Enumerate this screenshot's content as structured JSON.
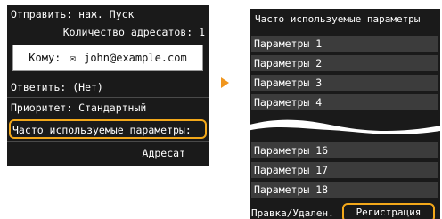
{
  "left_screen": {
    "send_hint": "Отправить: наж. Пуск",
    "recipients": "Количество адресатов: 1",
    "to_label": "Кому:",
    "to_value": "john@example.com",
    "reply_to": "Ответить: (Нет)",
    "priority": "Приоритет: Стандартный",
    "frequent_settings": "Часто используемые параметры:",
    "recipient_button": "Адресат"
  },
  "right_screen": {
    "title": "Часто используемые параметры",
    "items_top": [
      "Параметры 1",
      "Параметры 2",
      "Параметры 3",
      "Параметры 4"
    ],
    "items_bottom": [
      "Параметры 16",
      "Параметры 17",
      "Параметры 18"
    ],
    "edit_delete_button": "Правка/Удален.",
    "register_button": "Регистрация"
  },
  "colors": {
    "screen_bg": "#1a1a1a",
    "item_bg": "#3c3c3c",
    "highlight": "#f3a81a",
    "arrow": "#f0961e"
  },
  "icons": {
    "mail": "envelope-icon",
    "arrow": "right-arrow-icon"
  }
}
